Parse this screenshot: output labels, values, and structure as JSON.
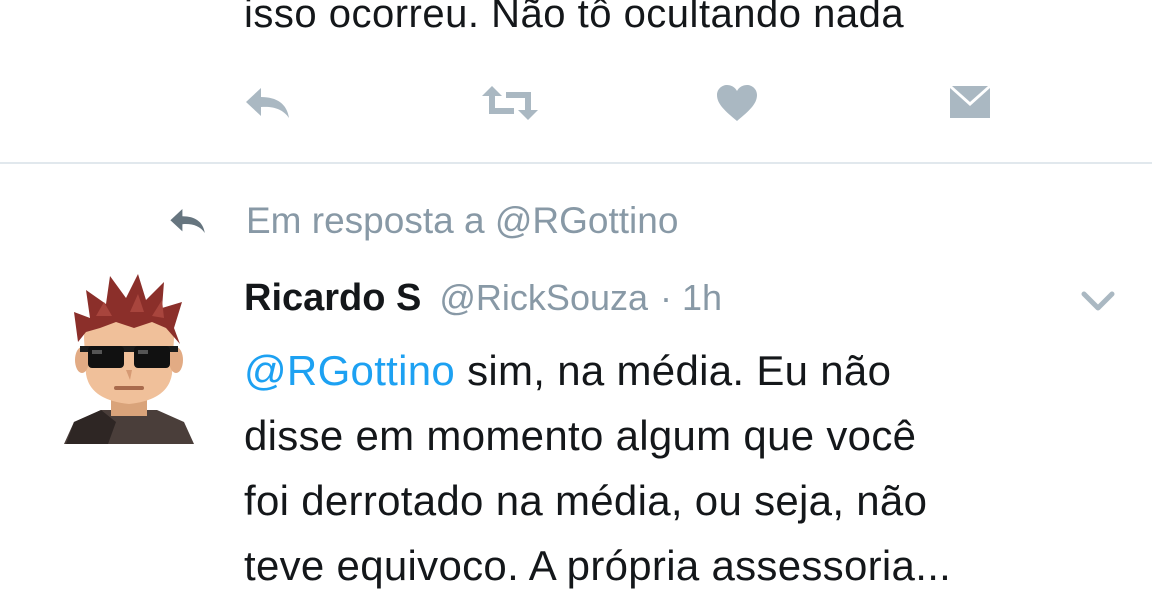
{
  "previous_tweet": {
    "text_fragment": "isso ocorreu. Não tô ocultando nada"
  },
  "actions": {
    "reply_icon": "reply-icon",
    "retweet_icon": "retweet-icon",
    "like_icon": "heart-icon",
    "dm_icon": "envelope-icon"
  },
  "tweet": {
    "reply_context": "Em resposta a @RGottino",
    "author_name": "Ricardo S",
    "handle": "@RickSouza",
    "separator": "·",
    "time": "1h",
    "mention": "@RGottino",
    "body_lines": [
      " sim, na média. Eu não",
      "disse em momento algum que você",
      "foi derrotado na média, ou seja, não",
      "teve equivoco. A própria assessoria..."
    ]
  },
  "colors": {
    "text": "#14171a",
    "muted": "#8899a6",
    "accent": "#1da1f2",
    "icon": "#aab8c2",
    "divider": "#e1e8ed"
  }
}
